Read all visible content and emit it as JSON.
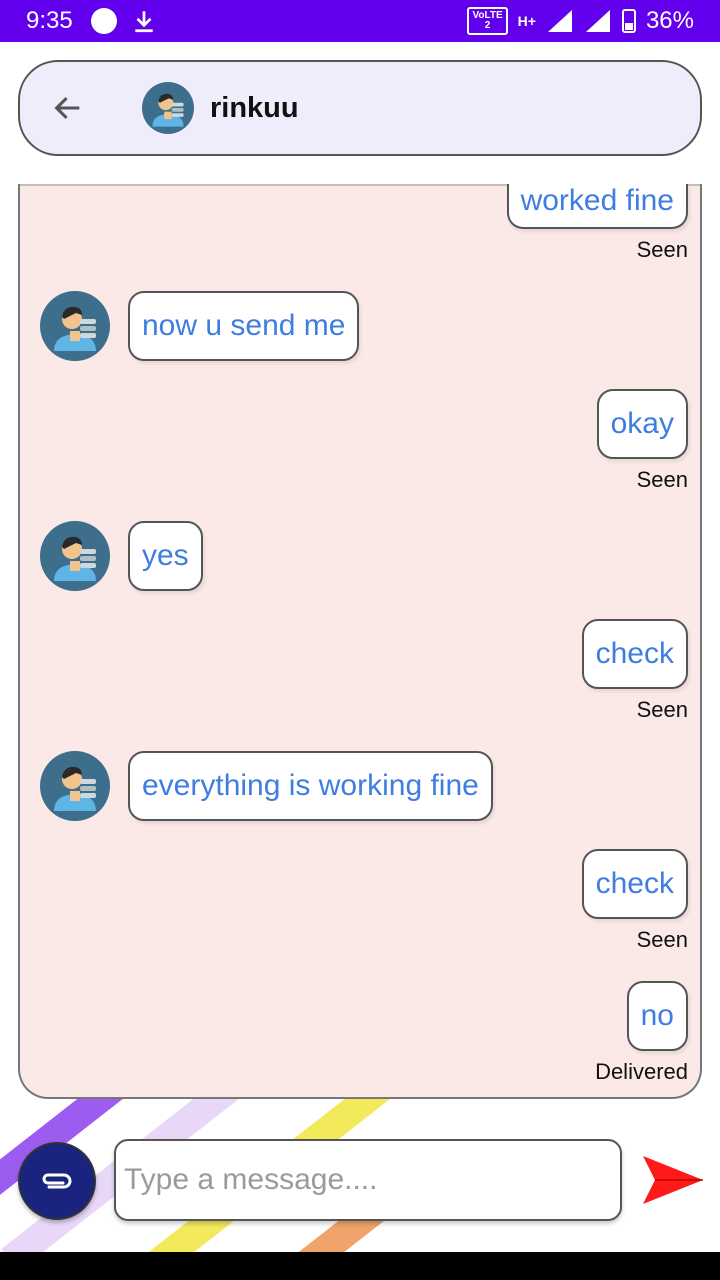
{
  "status_bar": {
    "time": "9:35",
    "network": "H+",
    "volte": "VoLTE",
    "volte_sim": "2",
    "battery": "36%"
  },
  "header": {
    "contact_name": "rinkuu",
    "back_icon": "arrow-left-icon",
    "avatar_icon": "user-avatar-icon"
  },
  "messages": [
    {
      "side": "right",
      "text": "worked fine",
      "status": "Seen"
    },
    {
      "side": "left",
      "text": "now u send me"
    },
    {
      "side": "right",
      "text": "okay",
      "status": "Seen"
    },
    {
      "side": "left",
      "text": "yes"
    },
    {
      "side": "right",
      "text": "check",
      "status": "Seen"
    },
    {
      "side": "left",
      "text": "everything is working fine"
    },
    {
      "side": "right",
      "text": "check",
      "status": "Seen"
    },
    {
      "side": "right",
      "text": "no",
      "status": "Delivered"
    }
  ],
  "composer": {
    "placeholder": "Type a message....",
    "value": "",
    "attach_icon": "paperclip-icon",
    "send_icon": "send-arrow-icon"
  },
  "colors": {
    "status_bar": "#6200ee",
    "header_bg": "#efedfc",
    "chat_bg": "#fbe9e8",
    "bubble_text": "#3f7ee0",
    "attach_button": "#1a237e",
    "send_arrow": "#ff0000"
  }
}
